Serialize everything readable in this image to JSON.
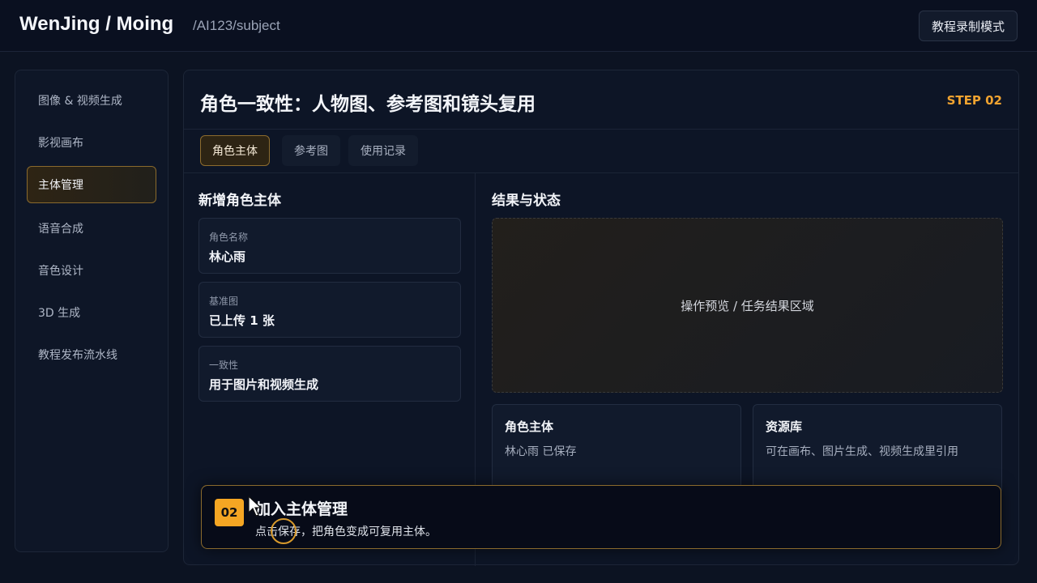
{
  "header": {
    "brand": "WenJing / Moing",
    "path": "/AI123/subject",
    "mode_button": "教程录制模式"
  },
  "sidebar": {
    "items": [
      {
        "label": "图像 & 视频生成",
        "active": false
      },
      {
        "label": "影视画布",
        "active": false
      },
      {
        "label": "主体管理",
        "active": true
      },
      {
        "label": "语音合成",
        "active": false
      },
      {
        "label": "音色设计",
        "active": false
      },
      {
        "label": "3D 生成",
        "active": false
      },
      {
        "label": "教程发布流水线",
        "active": false
      }
    ]
  },
  "main": {
    "title": "角色一致性：人物图、参考图和镜头复用",
    "step": "STEP 02",
    "tabs": [
      {
        "label": "角色主体",
        "active": true
      },
      {
        "label": "参考图",
        "active": false
      },
      {
        "label": "使用记录",
        "active": false
      }
    ],
    "form": {
      "title": "新增角色主体",
      "fields": [
        {
          "label": "角色名称",
          "value": "林心雨"
        },
        {
          "label": "基准图",
          "value": "已上传 1 张"
        },
        {
          "label": "一致性",
          "value": "用于图片和视频生成"
        }
      ]
    },
    "result": {
      "title": "结果与状态",
      "preview_text": "操作预览 / 任务结果区域",
      "cards": [
        {
          "title": "角色主体",
          "text": "林心雨 已保存"
        },
        {
          "title": "资源库",
          "text": "可在画布、图片生成、视频生成里引用"
        }
      ]
    }
  },
  "tip": {
    "badge": "02",
    "title": "加入主体管理",
    "text": "点击保存，把角色变成可复用主体。"
  },
  "colors": {
    "accent": "#f5a623",
    "background": "#0c1322"
  }
}
